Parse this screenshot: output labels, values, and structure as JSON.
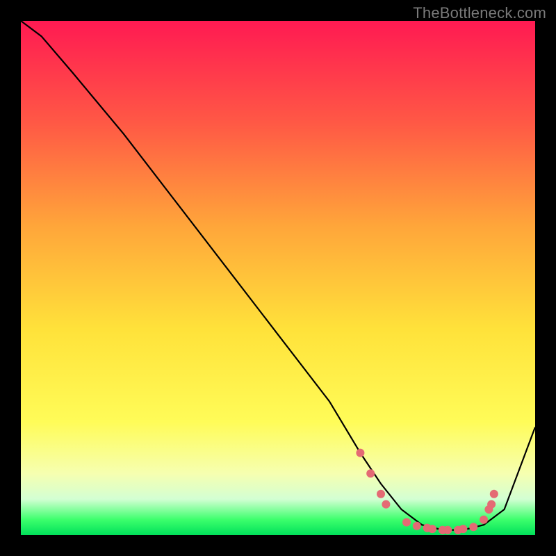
{
  "watermark": "TheBottleneck.com",
  "chart_data": {
    "type": "line",
    "title": "",
    "xlabel": "",
    "ylabel": "",
    "xlim": [
      0,
      100
    ],
    "ylim": [
      0,
      100
    ],
    "series": [
      {
        "name": "bottleneck-curve",
        "x": [
          0,
          4,
          10,
          20,
          30,
          40,
          50,
          60,
          66,
          70,
          74,
          78,
          82,
          86,
          90,
          94,
          100
        ],
        "y": [
          100,
          97,
          90,
          78,
          65,
          52,
          39,
          26,
          16,
          10,
          5,
          2,
          1,
          1,
          2,
          5,
          21
        ],
        "color": "#000000"
      }
    ],
    "markers": {
      "name": "highlight-points",
      "color": "#e46a74",
      "radius_px": 6,
      "points_xy": [
        [
          66,
          16
        ],
        [
          68,
          12
        ],
        [
          70,
          8
        ],
        [
          71,
          6
        ],
        [
          75,
          2.5
        ],
        [
          77,
          1.8
        ],
        [
          79,
          1.4
        ],
        [
          80,
          1.2
        ],
        [
          82,
          1.0
        ],
        [
          83,
          1.0
        ],
        [
          85,
          1.0
        ],
        [
          86,
          1.2
        ],
        [
          88,
          1.6
        ],
        [
          90,
          3.0
        ],
        [
          91,
          5.0
        ],
        [
          91.5,
          6.0
        ],
        [
          92,
          8.0
        ]
      ]
    }
  }
}
